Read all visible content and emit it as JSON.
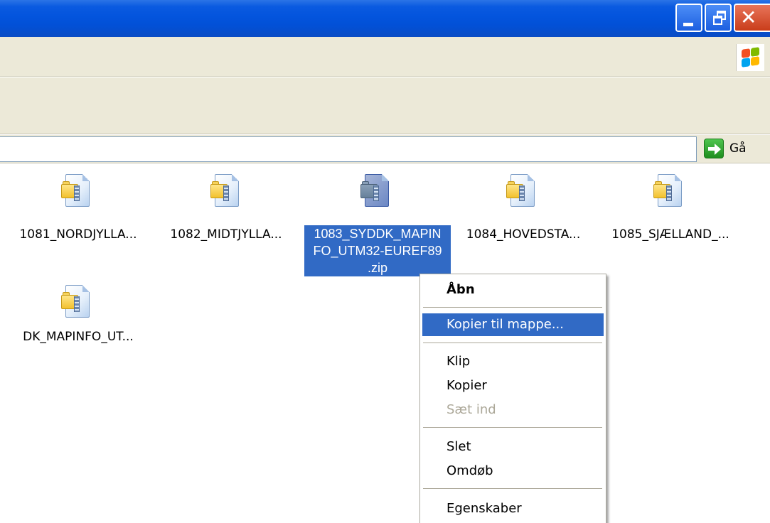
{
  "window": {
    "controls": {
      "minimize": "minimize",
      "maximize": "maximize",
      "close": "close"
    }
  },
  "address_bar": {
    "value": "",
    "go_label": "Gå"
  },
  "files": [
    {
      "name": "1081_NORDJYLLA..."
    },
    {
      "name": "1082_MIDTJYLLA..."
    },
    {
      "name": "1083_SYDDK_MAPINFO_UTM32-EUREF89.zip",
      "line1": "1083_SYDDK_MAPIN",
      "line2": "FO_UTM32-EUREF89",
      "line3": ".zip",
      "selected": true
    },
    {
      "name": "1084_HOVEDSTA..."
    },
    {
      "name": "1085_SJÆLLAND_..."
    },
    {
      "name": "DK_MAPINFO_UT..."
    }
  ],
  "context_menu": {
    "items": [
      {
        "label": "Åbn",
        "bold": true
      },
      {
        "label": "Kopier til mappe...",
        "highlighted": true
      },
      {
        "label": "Klip"
      },
      {
        "label": "Kopier"
      },
      {
        "label": "Sæt ind",
        "disabled": true
      },
      {
        "label": "Slet"
      },
      {
        "label": "Omdøb"
      },
      {
        "label": "Egenskaber"
      }
    ]
  },
  "colors": {
    "selection": "#316ac5",
    "titlebar": "#0354dd",
    "chrome": "#ece9d8"
  }
}
